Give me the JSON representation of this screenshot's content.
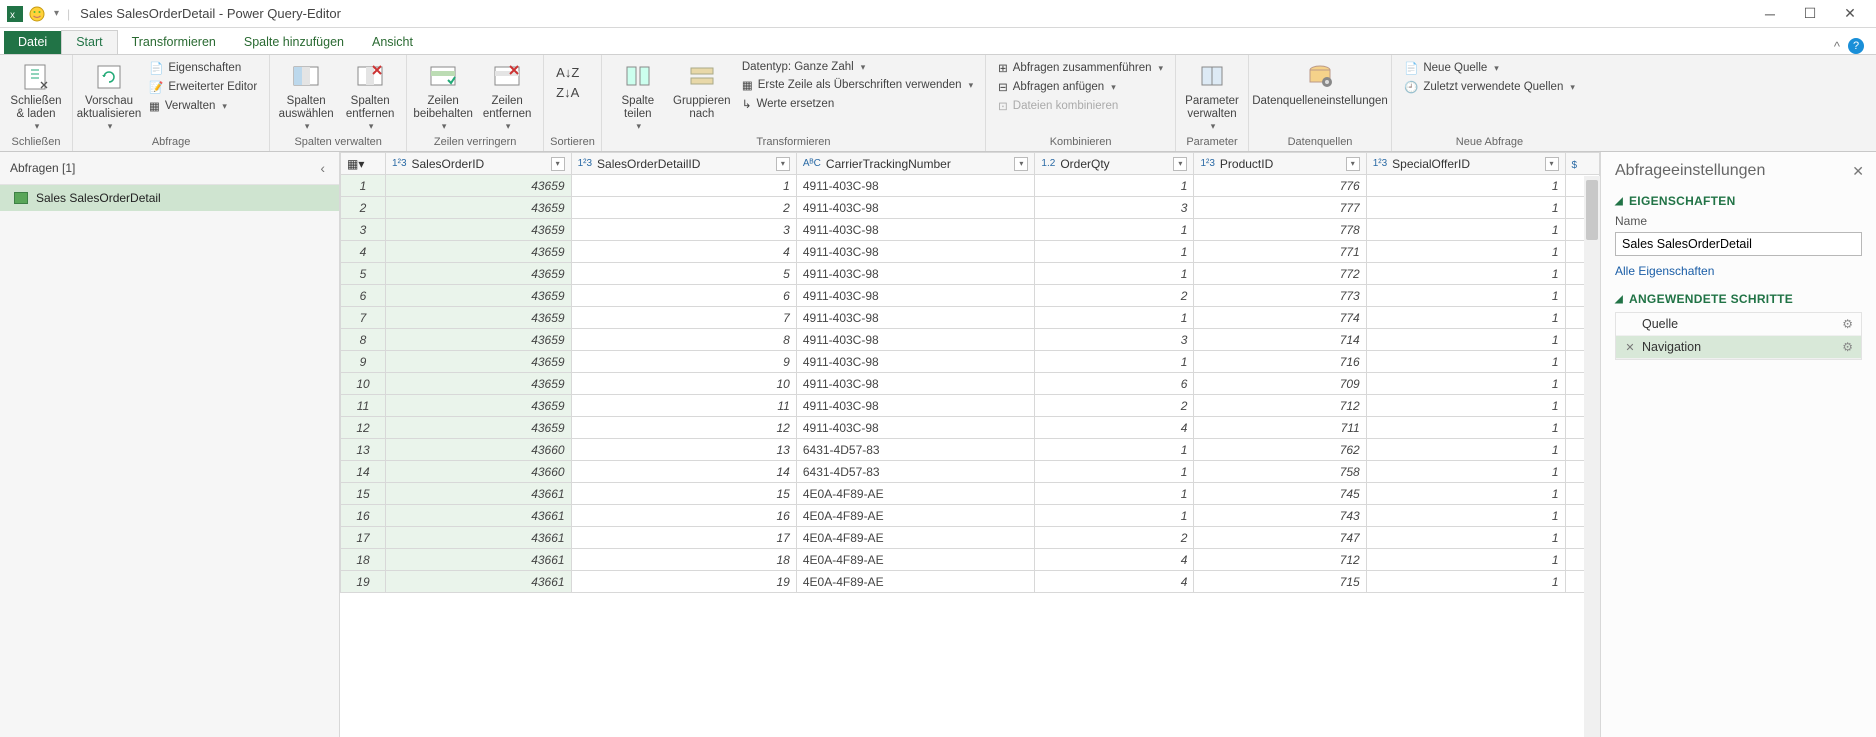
{
  "window": {
    "title": "Sales SalesOrderDetail - Power Query-Editor"
  },
  "tabs": {
    "file": "Datei",
    "start": "Start",
    "transform": "Transformieren",
    "addcol": "Spalte hinzufügen",
    "view": "Ansicht"
  },
  "ribbon": {
    "close_load": "Schließen\n& laden",
    "refresh": "Vorschau\naktualisieren",
    "properties": "Eigenschaften",
    "adv_editor": "Erweiterter Editor",
    "manage": "Verwalten",
    "choose_cols": "Spalten\nauswählen",
    "remove_cols": "Spalten\nentfernen",
    "keep_rows": "Zeilen\nbeibehalten",
    "remove_rows": "Zeilen\nentfernen",
    "split_col": "Spalte\nteilen",
    "groupby": "Gruppieren\nnach",
    "datatype": "Datentyp: Ganze Zahl",
    "firstrow": "Erste Zeile als Überschriften verwenden",
    "replace": "Werte ersetzen",
    "merge": "Abfragen zusammenführen",
    "append": "Abfragen anfügen",
    "combine_files": "Dateien kombinieren",
    "parameters": "Parameter\nverwalten",
    "datasources": "Datenquelleneinstellungen",
    "new_source": "Neue Quelle",
    "recent_sources": "Zuletzt verwendete Quellen",
    "g_close": "Schließen",
    "g_query": "Abfrage",
    "g_cols": "Spalten verwalten",
    "g_rows": "Zeilen verringern",
    "g_sort": "Sortieren",
    "g_transform": "Transformieren",
    "g_combine": "Kombinieren",
    "g_param": "Parameter",
    "g_ds": "Datenquellen",
    "g_new": "Neue Abfrage"
  },
  "queries": {
    "header": "Abfragen [1]",
    "item": "Sales SalesOrderDetail"
  },
  "columns": {
    "c1": "SalesOrderID",
    "c2": "SalesOrderDetailID",
    "c3": "CarrierTrackingNumber",
    "c4": "OrderQty",
    "c5": "ProductID",
    "c6": "SpecialOfferID"
  },
  "rows": [
    {
      "n": 1,
      "a": 43659,
      "b": 1,
      "c": "4911-403C-98",
      "d": 1,
      "e": 776,
      "f": 1
    },
    {
      "n": 2,
      "a": 43659,
      "b": 2,
      "c": "4911-403C-98",
      "d": 3,
      "e": 777,
      "f": 1
    },
    {
      "n": 3,
      "a": 43659,
      "b": 3,
      "c": "4911-403C-98",
      "d": 1,
      "e": 778,
      "f": 1
    },
    {
      "n": 4,
      "a": 43659,
      "b": 4,
      "c": "4911-403C-98",
      "d": 1,
      "e": 771,
      "f": 1
    },
    {
      "n": 5,
      "a": 43659,
      "b": 5,
      "c": "4911-403C-98",
      "d": 1,
      "e": 772,
      "f": 1
    },
    {
      "n": 6,
      "a": 43659,
      "b": 6,
      "c": "4911-403C-98",
      "d": 2,
      "e": 773,
      "f": 1
    },
    {
      "n": 7,
      "a": 43659,
      "b": 7,
      "c": "4911-403C-98",
      "d": 1,
      "e": 774,
      "f": 1
    },
    {
      "n": 8,
      "a": 43659,
      "b": 8,
      "c": "4911-403C-98",
      "d": 3,
      "e": 714,
      "f": 1
    },
    {
      "n": 9,
      "a": 43659,
      "b": 9,
      "c": "4911-403C-98",
      "d": 1,
      "e": 716,
      "f": 1
    },
    {
      "n": 10,
      "a": 43659,
      "b": 10,
      "c": "4911-403C-98",
      "d": 6,
      "e": 709,
      "f": 1
    },
    {
      "n": 11,
      "a": 43659,
      "b": 11,
      "c": "4911-403C-98",
      "d": 2,
      "e": 712,
      "f": 1
    },
    {
      "n": 12,
      "a": 43659,
      "b": 12,
      "c": "4911-403C-98",
      "d": 4,
      "e": 711,
      "f": 1
    },
    {
      "n": 13,
      "a": 43660,
      "b": 13,
      "c": "6431-4D57-83",
      "d": 1,
      "e": 762,
      "f": 1
    },
    {
      "n": 14,
      "a": 43660,
      "b": 14,
      "c": "6431-4D57-83",
      "d": 1,
      "e": 758,
      "f": 1
    },
    {
      "n": 15,
      "a": 43661,
      "b": 15,
      "c": "4E0A-4F89-AE",
      "d": 1,
      "e": 745,
      "f": 1
    },
    {
      "n": 16,
      "a": 43661,
      "b": 16,
      "c": "4E0A-4F89-AE",
      "d": 1,
      "e": 743,
      "f": 1
    },
    {
      "n": 17,
      "a": 43661,
      "b": 17,
      "c": "4E0A-4F89-AE",
      "d": 2,
      "e": 747,
      "f": 1
    },
    {
      "n": 18,
      "a": 43661,
      "b": 18,
      "c": "4E0A-4F89-AE",
      "d": 4,
      "e": 712,
      "f": 1
    },
    {
      "n": 19,
      "a": 43661,
      "b": 19,
      "c": "4E0A-4F89-AE",
      "d": 4,
      "e": 715,
      "f": 1
    }
  ],
  "settings": {
    "title": "Abfrageeinstellungen",
    "props": "EIGENSCHAFTEN",
    "name_label": "Name",
    "name_value": "Sales SalesOrderDetail",
    "all_props": "Alle Eigenschaften",
    "steps_cap": "ANGEWENDETE SCHRITTE",
    "step1": "Quelle",
    "step2": "Navigation"
  }
}
